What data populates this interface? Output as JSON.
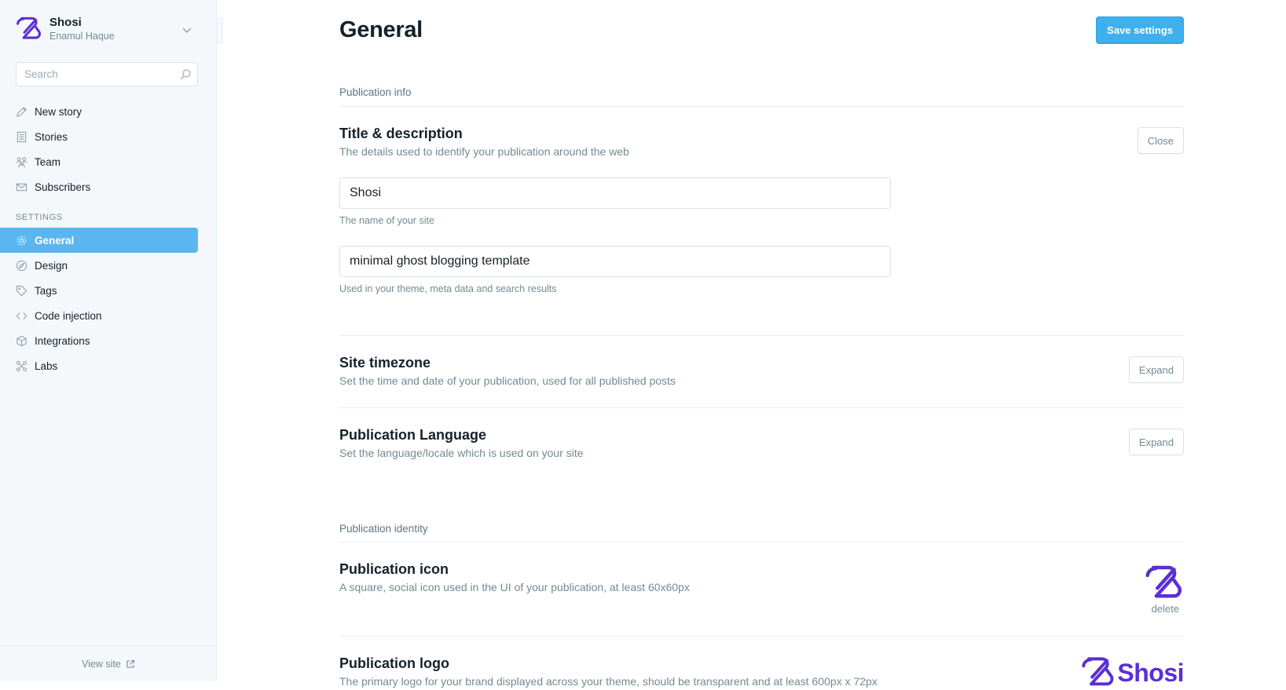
{
  "brand": {
    "name": "Shosi",
    "user": "Enamul Haque",
    "color": "#5b2fd3"
  },
  "search": {
    "placeholder": "Search",
    "icon": "search-icon"
  },
  "nav": {
    "items": [
      {
        "label": "New story",
        "icon": "pencil-icon"
      },
      {
        "label": "Stories",
        "icon": "document-icon"
      },
      {
        "label": "Team",
        "icon": "team-icon"
      },
      {
        "label": "Subscribers",
        "icon": "envelope-icon"
      }
    ],
    "settings_heading": "SETTINGS",
    "settings": [
      {
        "label": "General",
        "icon": "gear-icon",
        "active": true
      },
      {
        "label": "Design",
        "icon": "compass-icon"
      },
      {
        "label": "Tags",
        "icon": "tag-icon"
      },
      {
        "label": "Code injection",
        "icon": "code-icon"
      },
      {
        "label": "Integrations",
        "icon": "cube-icon"
      },
      {
        "label": "Labs",
        "icon": "labs-icon"
      }
    ],
    "active_color": "#5ab6f0"
  },
  "footer": {
    "view_site": "View site"
  },
  "header": {
    "title": "General",
    "save_label": "Save settings",
    "accent": "#3eb0ef"
  },
  "publication_info": {
    "label": "Publication info",
    "title_desc": {
      "title": "Title & description",
      "description": "The details used to identify your publication around the web",
      "button": "Close",
      "site_title": {
        "value": "Shosi",
        "hint": "The name of your site"
      },
      "site_description": {
        "value": "minimal ghost blogging template",
        "hint": "Used in your theme, meta data and search results"
      }
    },
    "timezone": {
      "title": "Site timezone",
      "description": "Set the time and date of your publication, used for all published posts",
      "button": "Expand"
    },
    "language": {
      "title": "Publication Language",
      "description": "Set the language/locale which is used on your site",
      "button": "Expand"
    }
  },
  "publication_identity": {
    "label": "Publication identity",
    "icon": {
      "title": "Publication icon",
      "description": "A square, social icon used in the UI of your publication, at least 60x60px",
      "delete_label": "delete"
    },
    "logo": {
      "title": "Publication logo",
      "description": "The primary logo for your brand displayed across your theme, should be transparent and at least 600px x 72px",
      "wordmark": "Shosi"
    }
  }
}
